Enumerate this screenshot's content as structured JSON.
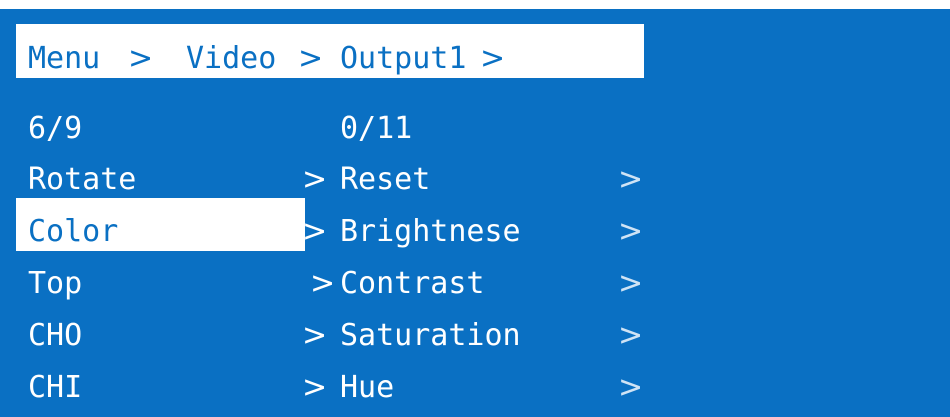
{
  "breadcrumb": {
    "items": [
      "Menu",
      "Video",
      "Output1"
    ],
    "separator": ">"
  },
  "left_column": {
    "counter": "6/9",
    "items": [
      "Rotate",
      "Color",
      "Top",
      "CHO",
      "CHI"
    ],
    "selected": "Color"
  },
  "right_column": {
    "counter": "0/11",
    "items": [
      "Reset",
      "Brightnese",
      "Contrast",
      "Saturation",
      "Hue"
    ]
  },
  "colors": {
    "background": "#0a70c3",
    "highlight": "#ffffff",
    "text": "#ffffff"
  }
}
